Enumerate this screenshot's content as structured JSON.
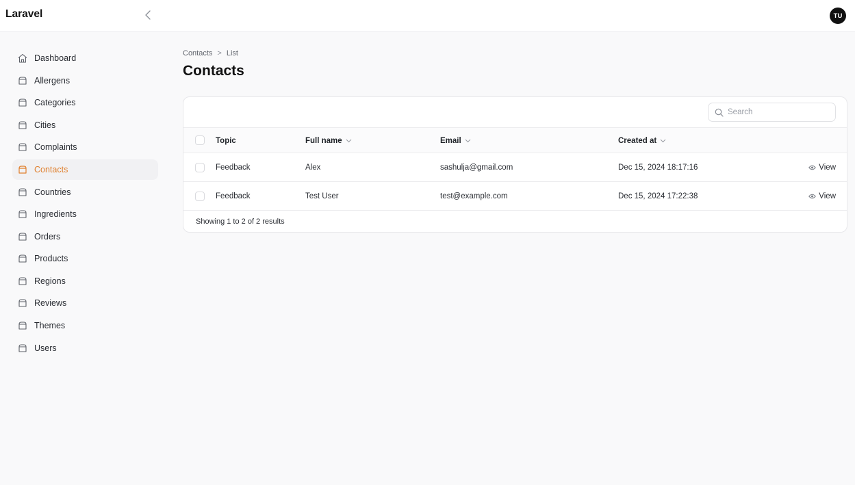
{
  "app": {
    "brand": "Laravel",
    "user_initials": "TU"
  },
  "sidebar": {
    "items": [
      {
        "label": "Dashboard",
        "icon": "home-icon"
      },
      {
        "label": "Allergens",
        "icon": "box-icon"
      },
      {
        "label": "Categories",
        "icon": "box-icon"
      },
      {
        "label": "Cities",
        "icon": "box-icon"
      },
      {
        "label": "Complaints",
        "icon": "box-icon"
      },
      {
        "label": "Contacts",
        "icon": "box-icon",
        "active": true
      },
      {
        "label": "Countries",
        "icon": "box-icon"
      },
      {
        "label": "Ingredients",
        "icon": "box-icon"
      },
      {
        "label": "Orders",
        "icon": "box-icon"
      },
      {
        "label": "Products",
        "icon": "box-icon"
      },
      {
        "label": "Regions",
        "icon": "box-icon"
      },
      {
        "label": "Reviews",
        "icon": "box-icon"
      },
      {
        "label": "Themes",
        "icon": "box-icon"
      },
      {
        "label": "Users",
        "icon": "box-icon"
      }
    ]
  },
  "breadcrumb": {
    "parent": "Contacts",
    "separator": ">",
    "current": "List"
  },
  "page": {
    "title": "Contacts"
  },
  "search": {
    "placeholder": "Search",
    "value": ""
  },
  "table": {
    "columns": [
      {
        "label": "Topic",
        "sortable": false
      },
      {
        "label": "Full name",
        "sortable": true
      },
      {
        "label": "Email",
        "sortable": true
      },
      {
        "label": "Created at",
        "sortable": true
      }
    ],
    "rows": [
      {
        "topic": "Feedback",
        "full_name": "Alex",
        "email": "sashulja@gmail.com",
        "created_at": "Dec 15, 2024 18:17:16",
        "action": "View"
      },
      {
        "topic": "Feedback",
        "full_name": "Test User",
        "email": "test@example.com",
        "created_at": "Dec 15, 2024 17:22:38",
        "action": "View"
      }
    ],
    "footer": "Showing 1 to 2 of 2 results"
  },
  "colors": {
    "accent": "#e07f2c",
    "text": "#1f2328",
    "border": "#ececee"
  }
}
